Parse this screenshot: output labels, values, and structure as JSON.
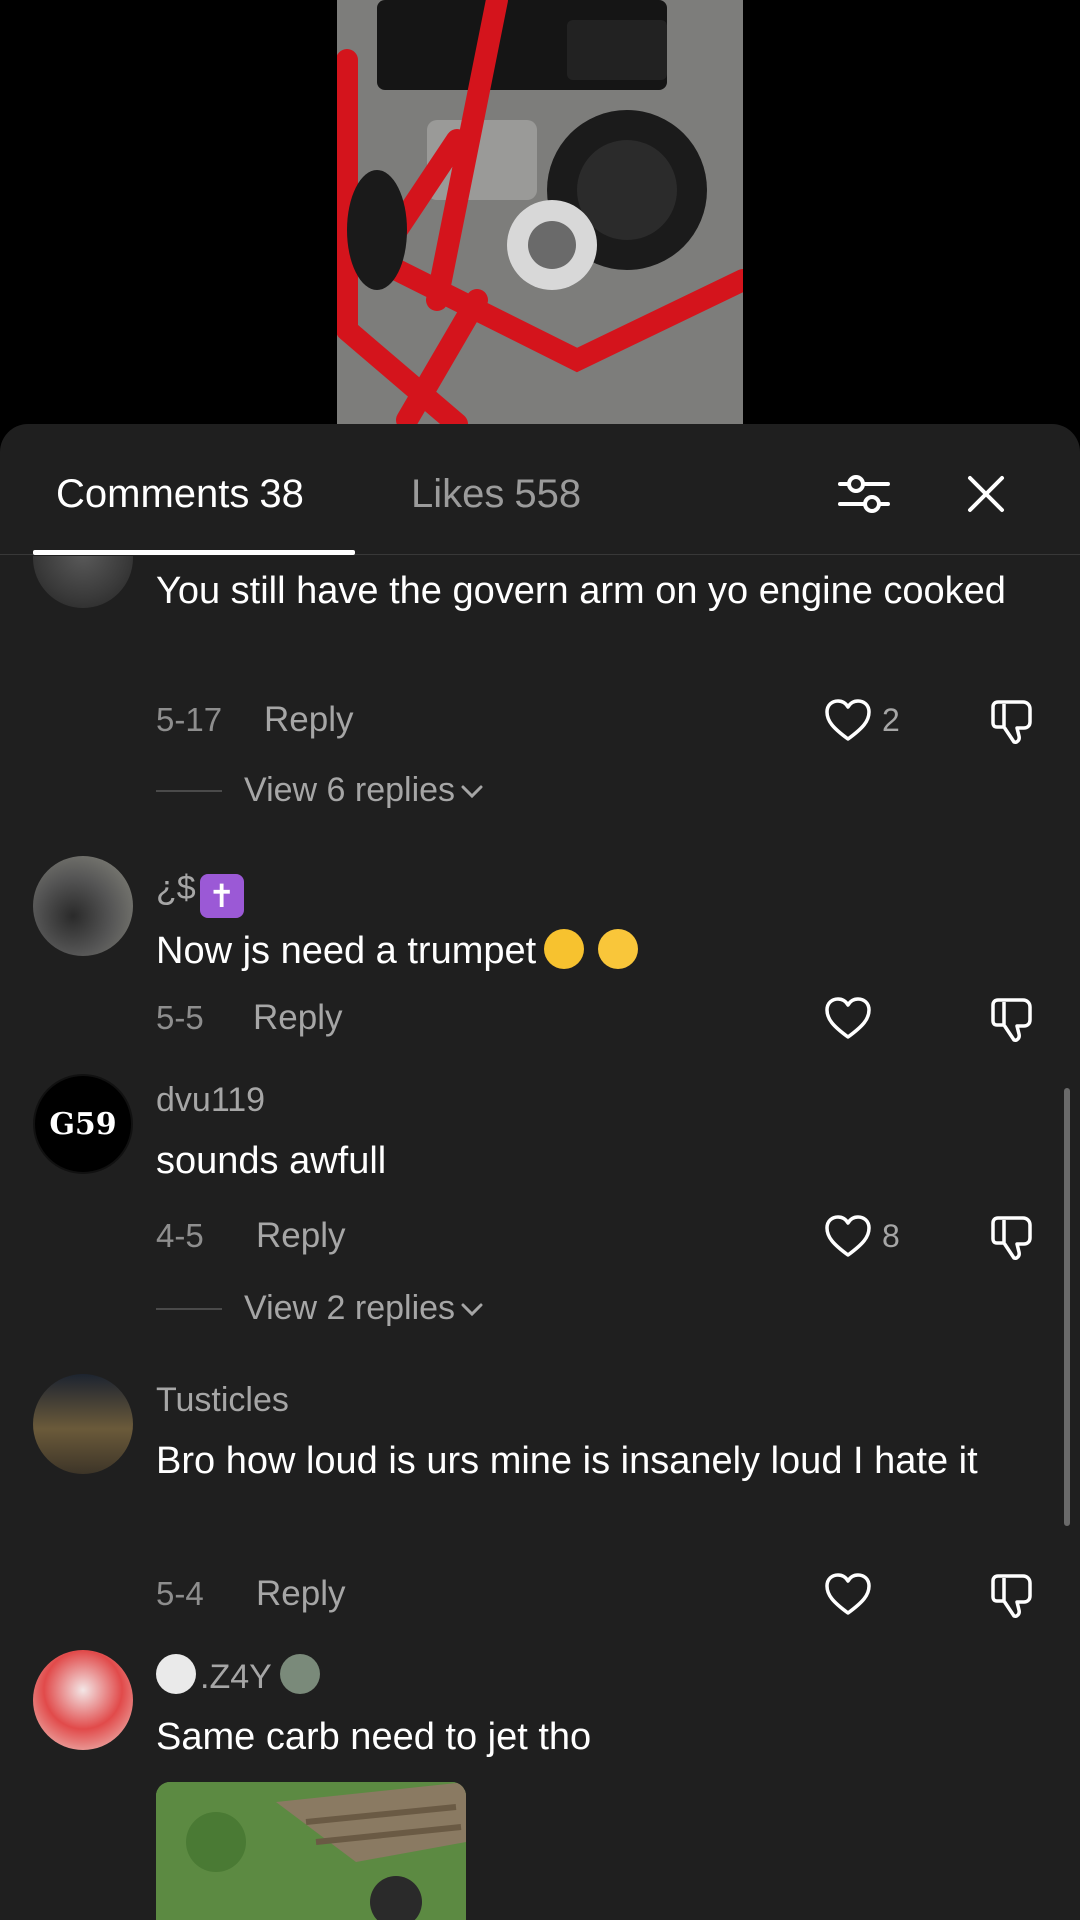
{
  "header": {
    "comments_label": "Comments",
    "comments_count": "38",
    "likes_label": "Likes",
    "likes_count": "558"
  },
  "comments": [
    {
      "username": "",
      "text": "You still have the govern arm on yo engine cooked",
      "date": "5-17",
      "reply_label": "Reply",
      "likes": "2",
      "view_replies": "View 6 replies"
    },
    {
      "username": "¿$",
      "text": "Now js need a trumpet",
      "date": "5-5",
      "reply_label": "Reply",
      "likes": ""
    },
    {
      "username": "dvu119",
      "avatar_text": "G59",
      "text": "sounds awfull",
      "date": "4-5",
      "reply_label": "Reply",
      "likes": "8",
      "view_replies": "View 2 replies"
    },
    {
      "username": "Tusticles",
      "text": "Bro how loud is urs mine is insanely loud I hate it",
      "date": "5-4",
      "reply_label": "Reply",
      "likes": ""
    },
    {
      "username": ".Z4Y",
      "text": "Same carb need to jet tho"
    }
  ],
  "icons": {
    "filter": "sliders-icon",
    "close": "close-icon",
    "like": "heart-outline-icon",
    "dislike": "thumbs-down-icon",
    "expand": "chevron-down-icon"
  }
}
